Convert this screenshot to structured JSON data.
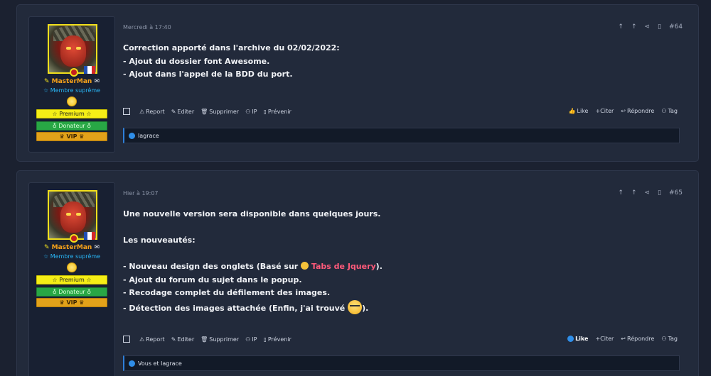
{
  "posts": [
    {
      "date": "Mercredi à 17:40",
      "number": "#64",
      "user": {
        "name": "MasterMan",
        "rank": "Membre suprême",
        "badges": [
          "☆ Premium ☆",
          "♁ Donateur ♁",
          "♛ VIP ♛"
        ]
      },
      "lines": [
        "Correction apporté dans l'archive du 02/02/2022:",
        "- Ajout du dossier font Awesome.",
        "- Ajout dans l'appel de la BDD du port."
      ],
      "actions_left": [
        "Report",
        "Editer",
        "Supprimer",
        "IP",
        "Prévenir"
      ],
      "actions_right": [
        "Like",
        "+Citer",
        "Répondre",
        "Tag"
      ],
      "reactions": "lagrace"
    },
    {
      "date": "Hier à 19:07",
      "number": "#65",
      "user": {
        "name": "MasterMan",
        "rank": "Membre suprême",
        "badges": [
          "☆ Premium ☆",
          "♁ Donateur ♁",
          "♛ VIP ♛"
        ]
      },
      "lines": {
        "l1": "Une nouvelle version sera disponible dans quelques jours.",
        "l2": "Les nouveautés:",
        "l3a": "- Nouveau design des onglets (Basé sur ",
        "l3link": "Tabs de Jquery",
        "l3b": ").",
        "l4": "- Ajout du forum du sujet dans le popup.",
        "l5": "- Recodage complet du défilement des images.",
        "l6a": "- Détection des images attachée (Enfin, j'ai trouvé ",
        "l6b": ")."
      },
      "actions_left": [
        "Report",
        "Editer",
        "Supprimer",
        "IP",
        "Prévenir"
      ],
      "actions_right": [
        "Like",
        "+Citer",
        "Répondre",
        "Tag"
      ],
      "reactions": "Vous et lagrace"
    }
  ],
  "colors": {
    "username": "#f7a21a",
    "rank": "#29b6f6",
    "link": "#ff5a7a",
    "accent": "#2f7fd8"
  }
}
